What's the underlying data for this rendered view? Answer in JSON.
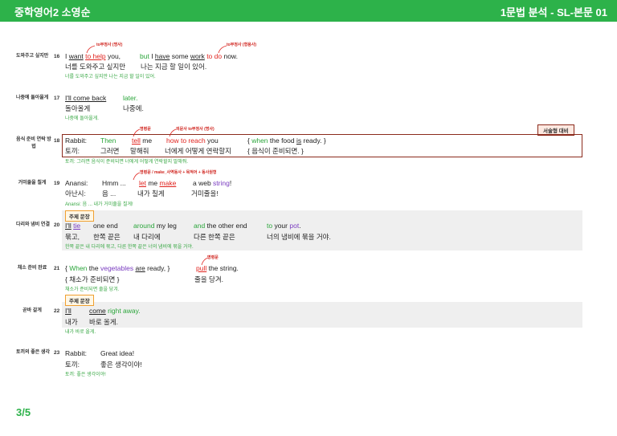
{
  "header": {
    "left": "중학영어2 소영순",
    "right": "1문법 분석 - SL-본문 01"
  },
  "page": "3/5",
  "rows": [
    {
      "label": "도와주고 싶지만",
      "num": "16",
      "ann1": "to부정사 (명사)",
      "ann2": "to부정사 (형용사)",
      "en": [
        "I ",
        "want",
        " ",
        "to help",
        " you,",
        "but I ",
        "have",
        " some ",
        "work",
        " to do",
        " now."
      ],
      "ko": [
        "너를 도와주고 싶지만",
        "나는 지금 할 일이 있어."
      ],
      "tr": "너를 도와주고 싶지만 나는 지금 할 일이 있어."
    },
    {
      "label": "나중에 돌아올게",
      "num": "17",
      "en": [
        "I'll come back",
        "later."
      ],
      "ko": [
        "돌아올게",
        "나중에."
      ],
      "tr": "나중에 돌아올게."
    },
    {
      "label": "음식 준비 연락 방법",
      "num": "18",
      "ann1": "명령문",
      "ann2": "의문사 to부정사 (명사)",
      "tag": "서술형 대비",
      "en": [
        "Rabbit:",
        "Then",
        "tell",
        " me",
        "how to reach",
        " you",
        "{ ",
        "when",
        " the food ",
        "is",
        " ready. }"
      ],
      "ko": [
        "토끼:",
        "그러면",
        "말해줘",
        "너에게 어떻게 연락할지",
        "{ 음식이 준비되면. }"
      ],
      "tr": "토끼: 그러면 음식이 준비되면 너에게 어떻게 연락할지 말해줘."
    },
    {
      "label": "거미줄을 칠게",
      "num": "19",
      "ann1": "명령문 / make_사역동사 + 목적어 + 동사원형",
      "en": [
        "Anansi:",
        "Hmm ...",
        "let",
        " me ",
        "make",
        "a web ",
        "string",
        "!"
      ],
      "ko": [
        "아난시:",
        "음 ...",
        "내가 칠게",
        "거미줄을!"
      ],
      "tr": "Anansi: 음 ... 내가 거미줄을 칠게!"
    },
    {
      "label": "다리와 냄비 연결",
      "num": "20",
      "tag": "주제 문장",
      "en": [
        "I'll",
        " ",
        "tie",
        "one end",
        "around",
        " my leg",
        "and",
        " the other end",
        "to",
        " your ",
        "pot",
        "."
      ],
      "ko": [
        "묶고,",
        "한쪽 끝은",
        "내 다리에",
        "다른 한쪽 끝은",
        "너의 냄비에 묶을 거야."
      ],
      "tr": "한쪽 끝은 내 다리에 묶고, 다른 한쪽 끝은 너의 냄비에 묶을 거야."
    },
    {
      "label": "채소 준비 완료",
      "num": "21",
      "ann1": "명령문",
      "en": [
        "{ ",
        "When",
        " the ",
        "vegetables",
        " ",
        "are",
        " ready, }",
        "pull",
        " the string."
      ],
      "ko": [
        "{ 채소가 준비되면 }",
        "줄을 당겨."
      ],
      "tr": "채소가 준비되면 줄을 당겨."
    },
    {
      "label": "곧바 갈게",
      "num": "22",
      "tag": "주제 문장",
      "en": [
        "I'll",
        "come",
        " right away."
      ],
      "ko": [
        "내가",
        "바로 올게."
      ],
      "tr": "내가 바로 올게."
    },
    {
      "label": "토끼의 좋은 생각",
      "num": "23",
      "en": [
        "Rabbit:",
        "Great idea!"
      ],
      "ko": [
        "토끼:",
        "좋은 생각이야!"
      ],
      "tr": "토끼: 좋은 생각이야!"
    }
  ],
  "colors": {
    "header": "#2db24a",
    "green": "#2aa53a",
    "red": "#e0231e",
    "purple": "#7a3cc0",
    "box": "#8b2a1c"
  }
}
